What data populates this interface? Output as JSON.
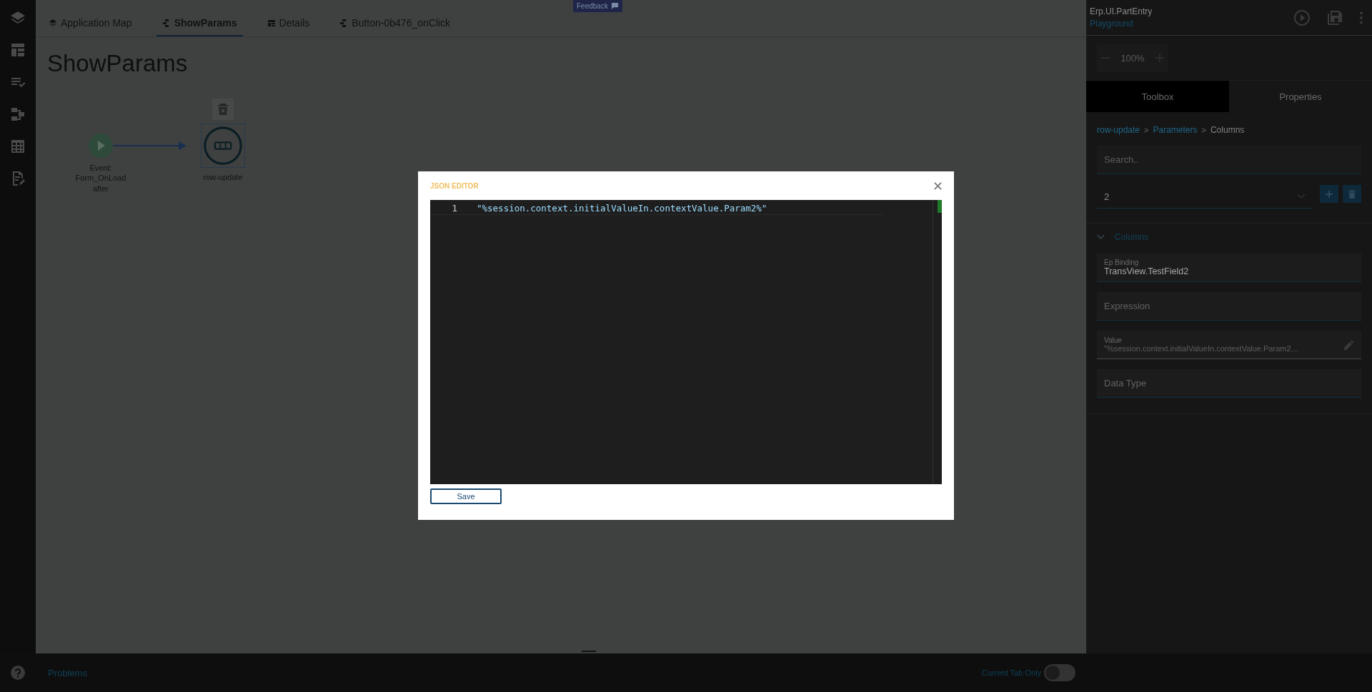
{
  "feedback_button": {
    "label": "Feedback"
  },
  "tabs": [
    {
      "label": "Application Map",
      "kind": "map",
      "selected": false
    },
    {
      "label": "ShowParams",
      "kind": "flow",
      "selected": true
    },
    {
      "label": "Details",
      "kind": "grid",
      "selected": false
    },
    {
      "label": "Button-0b476_onClick",
      "kind": "flow",
      "selected": false
    }
  ],
  "canvas": {
    "title": "ShowParams",
    "nodes": [
      {
        "kind": "event",
        "lines": [
          "Event:",
          "Form_OnLoad",
          "after"
        ]
      },
      {
        "kind": "action",
        "lines": [
          "row-update"
        ],
        "selected": true
      }
    ]
  },
  "right_panel": {
    "header": {
      "title": "Erp.UI.PartEntry",
      "subtitle": "Playground"
    },
    "zoom": {
      "value": "100%"
    },
    "tabs": [
      {
        "label": "Toolbox",
        "selected": true
      },
      {
        "label": "Properties",
        "selected": false
      }
    ],
    "breadcrumb": [
      {
        "label": "row-update",
        "kind": "link"
      },
      {
        "label": ">",
        "kind": "separator"
      },
      {
        "label": "Parameters",
        "kind": "link"
      },
      {
        "label": ">",
        "kind": "separator"
      },
      {
        "label": "Columns",
        "kind": "current"
      }
    ],
    "search": {
      "placeholder": "Search.."
    },
    "select": {
      "value": "2"
    },
    "section": {
      "title": "Columns",
      "expanded": true
    },
    "fields": [
      {
        "label": "Ep Binding",
        "value": "TransView.TestField2",
        "kind": "text"
      },
      {
        "placeholder": "Expression",
        "kind": "text"
      },
      {
        "label": "Value",
        "value": "\"%session.context.initialValueIn.contextValue.Param2…",
        "kind": "editable"
      },
      {
        "placeholder": "Data Type",
        "kind": "text"
      }
    ]
  },
  "modal": {
    "title": "JSON EDITOR",
    "lines": [
      {
        "number": "1",
        "text": "\"%session.context.initialValueIn.contextValue.Param2%\""
      }
    ],
    "save_button": "Save"
  },
  "bottom_bar": {
    "problems": "Problems",
    "current_tab_only": {
      "label": "Current Tab Only",
      "on": false
    }
  }
}
